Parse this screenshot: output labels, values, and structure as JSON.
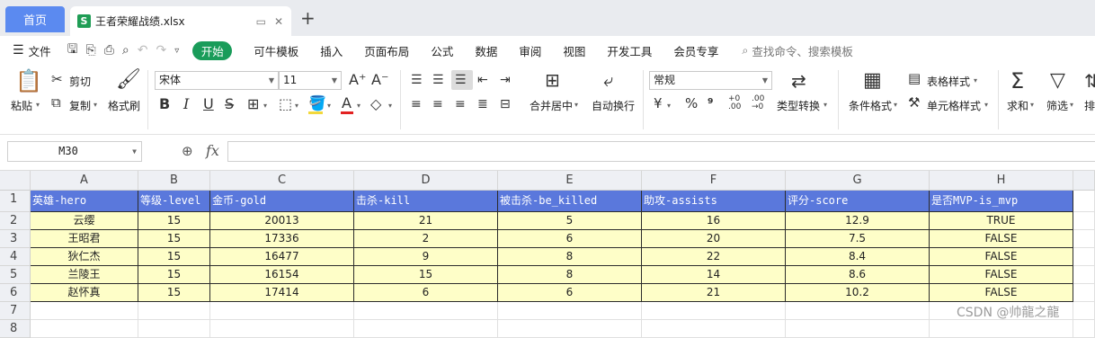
{
  "tabs": {
    "home": "首页",
    "file_icon": "S",
    "file": "王者荣耀战绩.xlsx"
  },
  "menu": {
    "file": "文件",
    "start": "开始",
    "items": [
      "可牛模板",
      "插入",
      "页面布局",
      "公式",
      "数据",
      "审阅",
      "视图",
      "开发工具",
      "会员专享"
    ],
    "search": "查找命令、搜索模板"
  },
  "ribbon": {
    "paste": "粘贴",
    "cut": "剪切",
    "copy": "复制",
    "format_painter": "格式刷",
    "font": "宋体",
    "size": "11",
    "merge": "合并居中",
    "wrap": "自动换行",
    "number_format": "常规",
    "type_convert": "类型转换",
    "cond_format": "条件格式",
    "table_style": "表格样式",
    "cell_style": "单元格样式",
    "sum": "求和",
    "filter": "筛选",
    "sort": "排"
  },
  "formula": {
    "name_box": "M30",
    "fx": "fx",
    "value": ""
  },
  "sheet": {
    "columns": [
      "A",
      "B",
      "C",
      "D",
      "E",
      "F",
      "G",
      "H"
    ],
    "rows": [
      "1",
      "2",
      "3",
      "4",
      "5",
      "6",
      "7",
      "8"
    ],
    "header": [
      "英雄-hero",
      "等级-level",
      "金币-gold",
      "击杀-kill",
      "被击杀-be_killed",
      "助攻-assists",
      "评分-score",
      "是否MVP-is_mvp"
    ],
    "data": [
      [
        "云缨",
        "15",
        "20013",
        "21",
        "5",
        "16",
        "12.9",
        "TRUE"
      ],
      [
        "王昭君",
        "15",
        "17336",
        "2",
        "6",
        "20",
        "7.5",
        "FALSE"
      ],
      [
        "狄仁杰",
        "15",
        "16477",
        "9",
        "8",
        "22",
        "8.4",
        "FALSE"
      ],
      [
        "兰陵王",
        "15",
        "16154",
        "15",
        "8",
        "14",
        "8.6",
        "FALSE"
      ],
      [
        "赵怀真",
        "15",
        "17414",
        "6",
        "6",
        "21",
        "10.2",
        "FALSE"
      ]
    ]
  },
  "watermark": "CSDN @帅龍之龍",
  "colors": {
    "header_fill": "#5a78dc",
    "data_fill": "#fefec8",
    "start_button": "#1a9c5a",
    "home_tab": "#5b8af0"
  }
}
